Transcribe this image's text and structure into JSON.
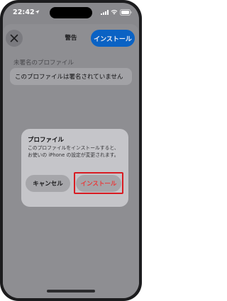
{
  "status_bar": {
    "time": "22:42",
    "location_icon": "location-arrow-icon",
    "signal_icon": "cellular-signal-icon",
    "wifi_icon": "wifi-icon",
    "battery_icon": "battery-icon"
  },
  "header": {
    "close_icon": "close-icon",
    "title": "警告",
    "install_label": "インストール"
  },
  "content": {
    "section_label": "未署名のプロファイル",
    "row_text": "このプロファイルは署名されていません"
  },
  "alert": {
    "title": "プロファイル",
    "message_line1": "このプロファイルをインストールすると、",
    "message_line2": "お使いの iPhone の設定が変更されます。",
    "cancel_label": "キャンセル",
    "install_label": "インストール"
  },
  "colors": {
    "accent": "#0a62c4",
    "destructive": "#e83a3a",
    "highlight": "#d81b22"
  }
}
